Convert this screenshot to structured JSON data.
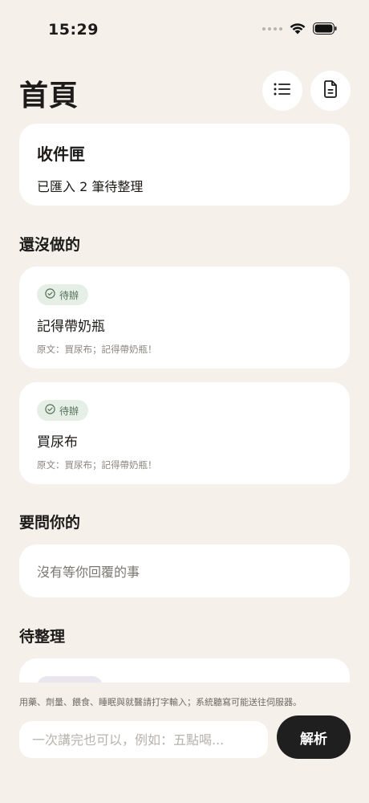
{
  "status_bar": {
    "time": "15:29"
  },
  "header": {
    "title": "首頁"
  },
  "inbox": {
    "title": "收件匣",
    "summary": "已匯入 2 筆待整理"
  },
  "sections": {
    "todo_heading": "還沒做的",
    "ask_heading": "要問你的",
    "sort_heading": "待整理"
  },
  "tasks": [
    {
      "badge": "待辦",
      "title": "記得帶奶瓶",
      "source": "原文：買尿布；記得帶奶瓶！"
    },
    {
      "badge": "待辦",
      "title": "買尿布",
      "source": "原文：買尿布；記得帶奶瓶！"
    }
  ],
  "ask": {
    "empty_text": "沒有等你回覆的事"
  },
  "footer": {
    "notice": "用藥、劑量、餵食、睡眠與就醫請打字輸入；系統聽寫可能送往伺服器。",
    "input_placeholder": "一次講完也可以，例如：五點喝...",
    "parse_label": "解析"
  },
  "icons": {
    "list_button": "list-icon",
    "doc_button": "document-icon",
    "badge": "check-circle-icon"
  },
  "colors": {
    "background": "#f5f1ea",
    "card": "#ffffff",
    "badge_bg": "#e5efe6",
    "badge_text": "#55705a",
    "primary_button": "#1f1f1f"
  }
}
